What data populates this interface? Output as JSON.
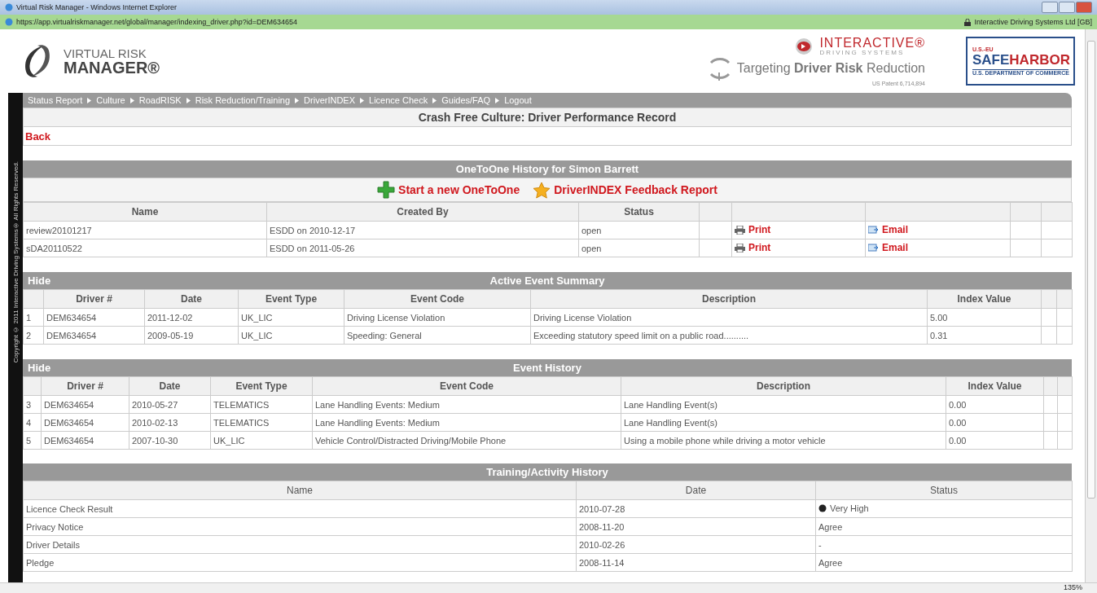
{
  "browser": {
    "title": "Virtual Risk Manager - Windows Internet Explorer",
    "url": "https://app.virtualriskmanager.net/global/manager/indexing_driver.php?id=DEM634654",
    "site_identity": "Interactive Driving Systems Ltd [GB]",
    "zoom": "135%"
  },
  "header": {
    "logo_top": "VIRTUAL RISK",
    "logo_bottom": "MANAGER®",
    "partner_name": "INTERACTIVE®",
    "partner_sub": "DRIVING SYSTEMS",
    "tagline": "Targeting **Driver Risk** Reduction",
    "patent": "US Patent 6,714,894",
    "badge_top": "U.S.-EU",
    "badge_first": "SAFE",
    "badge_second": "HARBOR",
    "badge_bottom": "U.S. DEPARTMENT OF COMMERCE"
  },
  "nav": [
    "Status Report",
    "Culture",
    "RoadRISK",
    "Risk Reduction/Training",
    "DriverINDEX",
    "Licence Check",
    "Guides/FAQ",
    "Logout"
  ],
  "copyright": "Copyright © 2011 Interactive Driving Systems® All Rights Reserved.",
  "page_title": "Crash Free Culture: Driver Performance Record",
  "back": "Back",
  "one_to_one": {
    "title": "OneToOne History for Simon Barrett",
    "actions": [
      {
        "kind": "plus",
        "label": "Start a new OneToOne"
      },
      {
        "kind": "star",
        "label": "DriverINDEX Feedback Report"
      }
    ],
    "columns": [
      "Name",
      "Created By",
      "Status"
    ],
    "rows": [
      {
        "name": "review20101217",
        "created_by": "ESDD on 2010-12-17",
        "status": "open",
        "print": "Print",
        "email": "Email"
      },
      {
        "name": "sDA20110522",
        "created_by": "ESDD on 2011-05-26",
        "status": "open",
        "print": "Print",
        "email": "Email"
      }
    ]
  },
  "event_tables": [
    {
      "hide": "Hide",
      "title": "Active Event Summary",
      "columns": [
        "",
        "Driver #",
        "Date",
        "Event Type",
        "Event Code",
        "Description",
        "Index Value"
      ],
      "rows": [
        [
          "1",
          "DEM634654",
          "2011-12-02",
          "UK_LIC",
          "Driving License Violation",
          "Driving License Violation",
          "5.00"
        ],
        [
          "2",
          "DEM634654",
          "2009-05-19",
          "UK_LIC",
          "Speeding: General",
          "Exceeding statutory speed limit on a public road..........",
          "0.31"
        ]
      ]
    },
    {
      "hide": "Hide",
      "title": "Event History",
      "columns": [
        "",
        "Driver #",
        "Date",
        "Event Type",
        "Event Code",
        "Description",
        "Index Value"
      ],
      "rows": [
        [
          "3",
          "DEM634654",
          "2010-05-27",
          "TELEMATICS",
          "Lane Handling Events: Medium",
          "Lane Handling Event(s)",
          "0.00"
        ],
        [
          "4",
          "DEM634654",
          "2010-02-13",
          "TELEMATICS",
          "Lane Handling Events: Medium",
          "Lane Handling Event(s)",
          "0.00"
        ],
        [
          "5",
          "DEM634654",
          "2007-10-30",
          "UK_LIC",
          "Vehicle Control/Distracted Driving/Mobile Phone",
          "Using a mobile phone while driving a motor vehicle",
          "0.00"
        ]
      ]
    }
  ],
  "training": {
    "title": "Training/Activity History",
    "columns": [
      "Name",
      "Date",
      "Status"
    ],
    "rows": [
      {
        "name": "Licence Check Result",
        "date": "2010-07-28",
        "status": "Very High",
        "dot": true
      },
      {
        "name": "Privacy Notice",
        "date": "2008-11-20",
        "status": "Agree",
        "dot": false
      },
      {
        "name": "Driver Details",
        "date": "2010-02-26",
        "status": "-",
        "dot": false
      },
      {
        "name": "Pledge",
        "date": "2008-11-14",
        "status": "Agree",
        "dot": false
      }
    ]
  }
}
